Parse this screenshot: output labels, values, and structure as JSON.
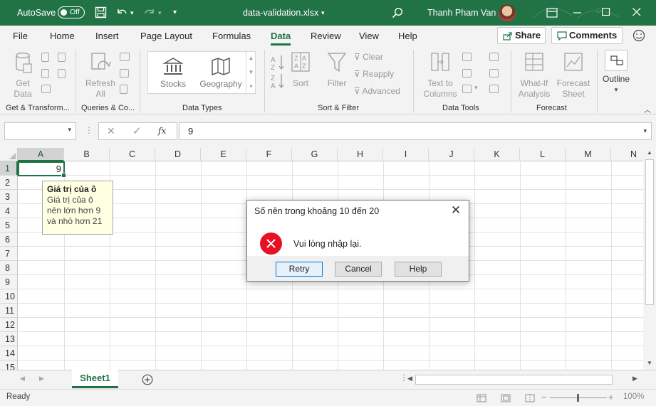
{
  "titlebar": {
    "autosave_label": "AutoSave",
    "autosave_state": "Off",
    "filename": "data-validation.xlsx",
    "user": "Thanh Pham Van",
    "accent": "#217346"
  },
  "menu": {
    "tabs": [
      "File",
      "Home",
      "Insert",
      "Page Layout",
      "Formulas",
      "Data",
      "Review",
      "View",
      "Help"
    ],
    "active": "Data",
    "share_label": "Share",
    "comments_label": "Comments"
  },
  "ribbon": {
    "get_data": "Get Data",
    "refresh_all": "Refresh All",
    "stocks": "Stocks",
    "geography": "Geography",
    "sort": "Sort",
    "filter": "Filter",
    "clear": "Clear",
    "reapply": "Reapply",
    "advanced": "Advanced",
    "text_to_columns": "Text to Columns",
    "what_if": "What-If Analysis",
    "forecast_sheet": "Forecast Sheet",
    "outline": "Outline",
    "groups": {
      "get_transform": "Get & Transform...",
      "queries": "Queries & Co...",
      "data_types": "Data Types",
      "sort_filter": "Sort & Filter",
      "data_tools": "Data Tools",
      "forecast": "Forecast"
    }
  },
  "formula_bar": {
    "name_box": "",
    "fx_label": "fx",
    "value": "9"
  },
  "grid": {
    "columns": [
      "A",
      "B",
      "C",
      "D",
      "E",
      "F",
      "G",
      "H",
      "I",
      "J",
      "K",
      "L",
      "M",
      "N"
    ],
    "rows": [
      "1",
      "2",
      "3",
      "4",
      "5",
      "6",
      "7",
      "8",
      "9",
      "10",
      "11",
      "12",
      "13",
      "14",
      "15"
    ],
    "active_cell_value": "9"
  },
  "tooltip": {
    "title": "Giá trị của ô",
    "body": "Giá trị của ô nên lớn hơn 9 và nhỏ hơn 21"
  },
  "dialog": {
    "title": "Số nên trong khoảng 10 đến 20",
    "message": "Vui lòng nhập lại.",
    "retry": "Retry",
    "cancel": "Cancel",
    "help": "Help"
  },
  "sheets": {
    "active": "Sheet1"
  },
  "status": {
    "ready": "Ready",
    "zoom": "100%"
  }
}
